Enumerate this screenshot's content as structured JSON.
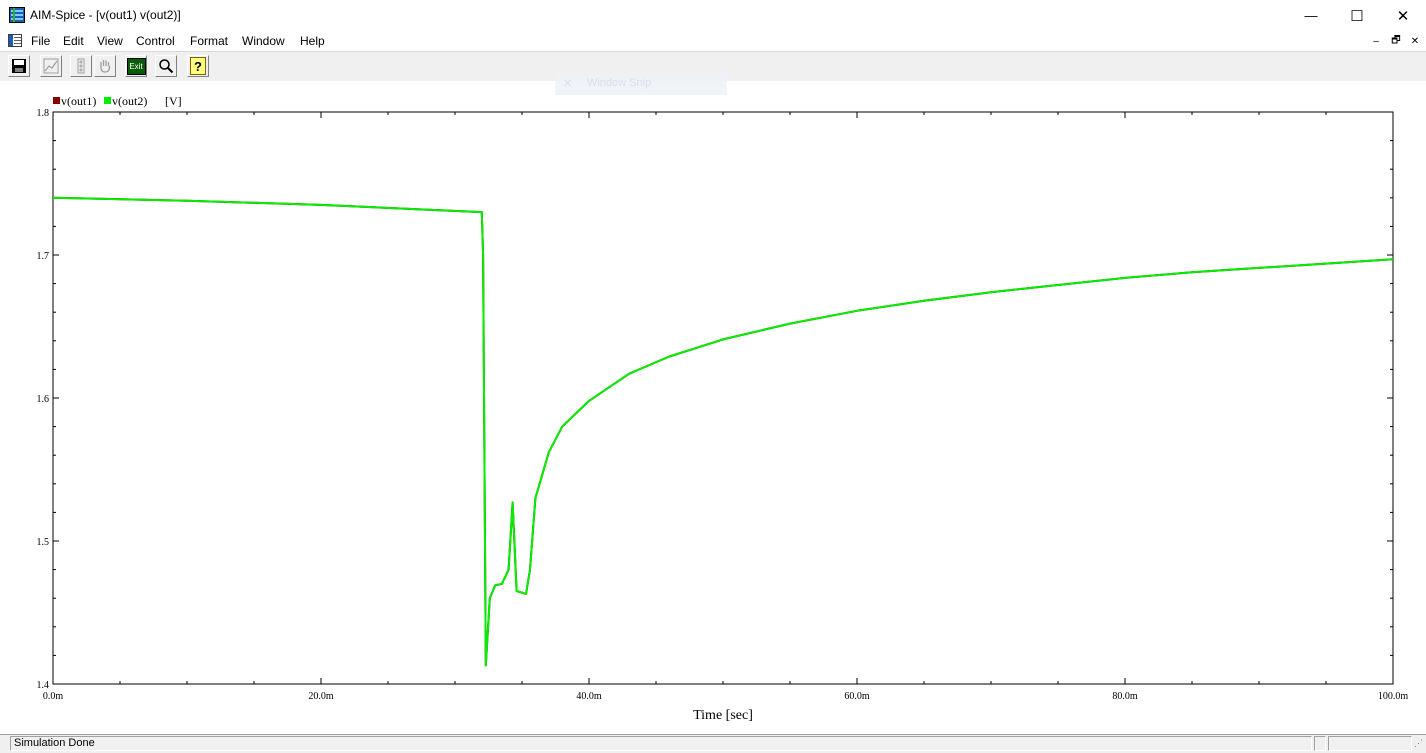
{
  "window": {
    "title": "AIM-Spice - [v(out1) v(out2)]",
    "minimize_glyph": "—",
    "maximize_glyph": "☐",
    "close_glyph": "✕"
  },
  "menu": {
    "items": [
      "File",
      "Edit",
      "View",
      "Control",
      "Format",
      "Window",
      "Help"
    ],
    "mdi_min": "–",
    "mdi_restore": "🗗",
    "mdi_close": "✕"
  },
  "toolbar": {
    "exit_label": "Exit",
    "help_label": "?",
    "icons": [
      "save-icon",
      "chart-icon",
      "traffic-light-icon",
      "hand-icon",
      "exit-icon",
      "zoom-icon",
      "help-icon"
    ]
  },
  "overlay": {
    "text": "Window Snip"
  },
  "status": {
    "text": "Simulation Done"
  },
  "colors": {
    "series1": "#8b0000",
    "series2": "#00ee00",
    "axes": "#000000"
  },
  "chart_data": {
    "type": "line",
    "xlabel": "Time [sec]",
    "ylabel": "",
    "units_label": "[V]",
    "xlim": [
      0,
      100
    ],
    "ylim": [
      1.4,
      1.8
    ],
    "x_unit_note": "ms",
    "x_ticks": [
      0,
      20,
      40,
      60,
      80,
      100
    ],
    "x_tick_labels": [
      "0.0m",
      "20.0m",
      "40.0m",
      "60.0m",
      "80.0m",
      "100.0m"
    ],
    "y_ticks": [
      1.4,
      1.5,
      1.6,
      1.7,
      1.8
    ],
    "y_tick_labels": [
      "1.4",
      "1.5",
      "1.6",
      "1.7",
      "1.8"
    ],
    "legend": "top-left",
    "series": [
      {
        "name": "v(out1)",
        "x": [
          0,
          10,
          20,
          32,
          32.1,
          32.3,
          32.6,
          33,
          33.5,
          34,
          34.3,
          34.6,
          35.3,
          35.6,
          36,
          37,
          38,
          40,
          43,
          46,
          50,
          55,
          60,
          65,
          70,
          75,
          80,
          85,
          90,
          95,
          100
        ],
        "y": [
          1.74,
          1.738,
          1.735,
          1.73,
          1.7,
          1.413,
          1.46,
          1.469,
          1.47,
          1.48,
          1.527,
          1.465,
          1.463,
          1.48,
          1.53,
          1.562,
          1.58,
          1.598,
          1.617,
          1.629,
          1.641,
          1.652,
          1.661,
          1.668,
          1.674,
          1.679,
          1.684,
          1.688,
          1.691,
          1.694,
          1.697
        ]
      },
      {
        "name": "v(out2)",
        "x": [
          0,
          10,
          20,
          32,
          32.1,
          32.3,
          32.6,
          33,
          33.5,
          34,
          34.3,
          34.6,
          35.3,
          35.6,
          36,
          37,
          38,
          40,
          43,
          46,
          50,
          55,
          60,
          65,
          70,
          75,
          80,
          85,
          90,
          95,
          100
        ],
        "y": [
          1.74,
          1.738,
          1.735,
          1.73,
          1.7,
          1.413,
          1.46,
          1.469,
          1.47,
          1.48,
          1.527,
          1.465,
          1.463,
          1.48,
          1.53,
          1.562,
          1.58,
          1.598,
          1.617,
          1.629,
          1.641,
          1.652,
          1.661,
          1.668,
          1.674,
          1.679,
          1.684,
          1.688,
          1.691,
          1.694,
          1.697
        ]
      }
    ]
  }
}
